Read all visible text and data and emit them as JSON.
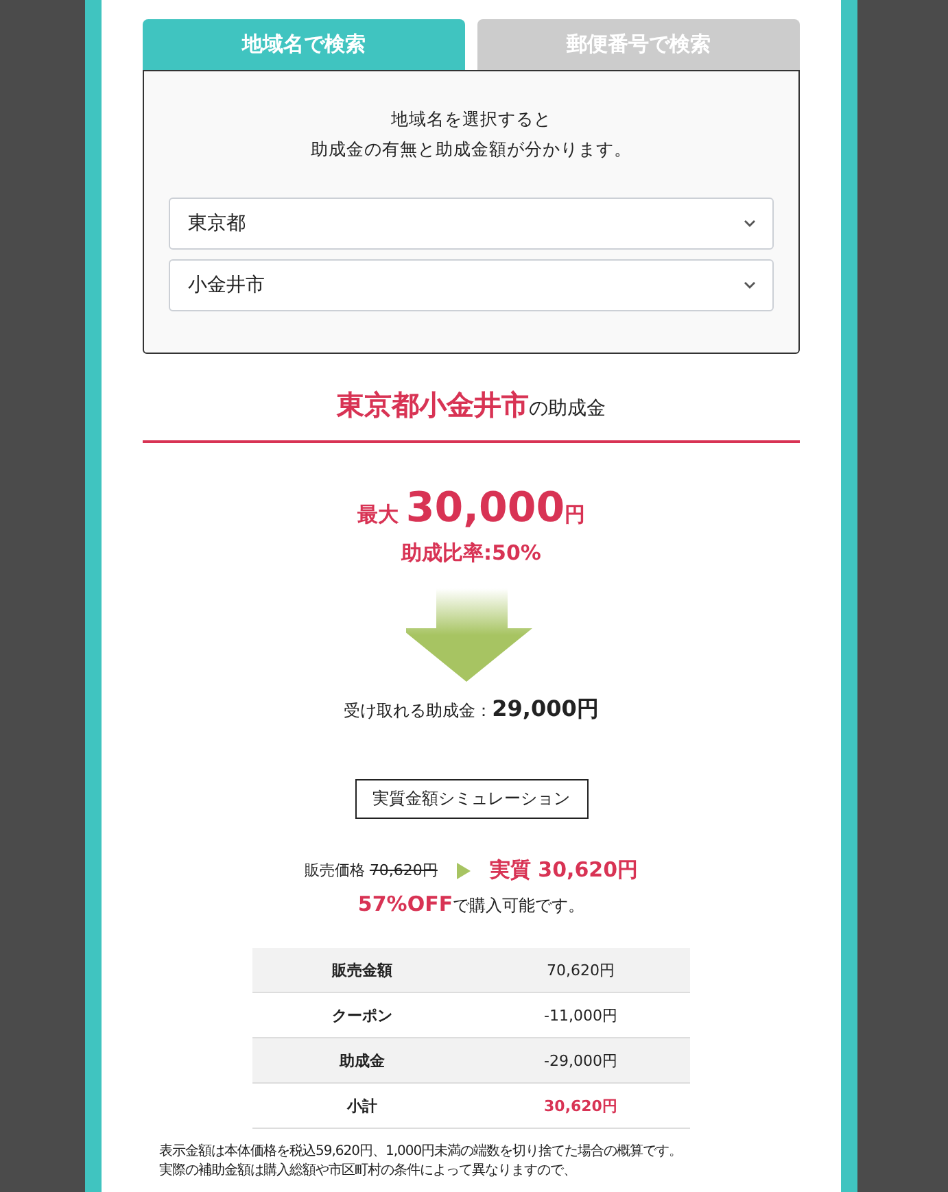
{
  "tabs": [
    {
      "label": "地域名で検索",
      "selected": true
    },
    {
      "label": "郵便番号で検索",
      "selected": false
    }
  ],
  "search_panel": {
    "intro_lines": [
      "地域名を選択すると",
      "助成金の有無と助成金額が分かります。"
    ],
    "selects": [
      {
        "value": "東京都"
      },
      {
        "value": "小金井市"
      }
    ]
  },
  "result": {
    "region": "東京都小金井市",
    "heading_suffix": "の助成金",
    "max_prefix": "最大",
    "max_amount": "30,000",
    "max_unit": "円",
    "rate": "助成比率:50%",
    "receivable_label": "受け取れる助成金：",
    "receivable_amount": "29,000円"
  },
  "simulation": {
    "button": "実質金額シミュレーション",
    "price_label": "販売価格",
    "original_price": "70,620円",
    "effective_price": "実質 30,620円",
    "discount": "57%OFF",
    "discount_suffix": "で購入可能です。",
    "rows": [
      {
        "label": "販売金額",
        "value": "70,620円",
        "emphasis": false
      },
      {
        "label": "クーポン",
        "value": "-11,000円",
        "emphasis": false
      },
      {
        "label": "助成金",
        "value": "-29,000円",
        "emphasis": false
      },
      {
        "label": "小計",
        "value": "30,620円",
        "emphasis": true
      }
    ],
    "notes": [
      "表示金額は本体価格を税込59,620円、1,000円未満の端数を切り捨てた場合の概算です。",
      "実際の補助金額は購入総額や市区町村の条件によって異なりますので、"
    ]
  }
}
